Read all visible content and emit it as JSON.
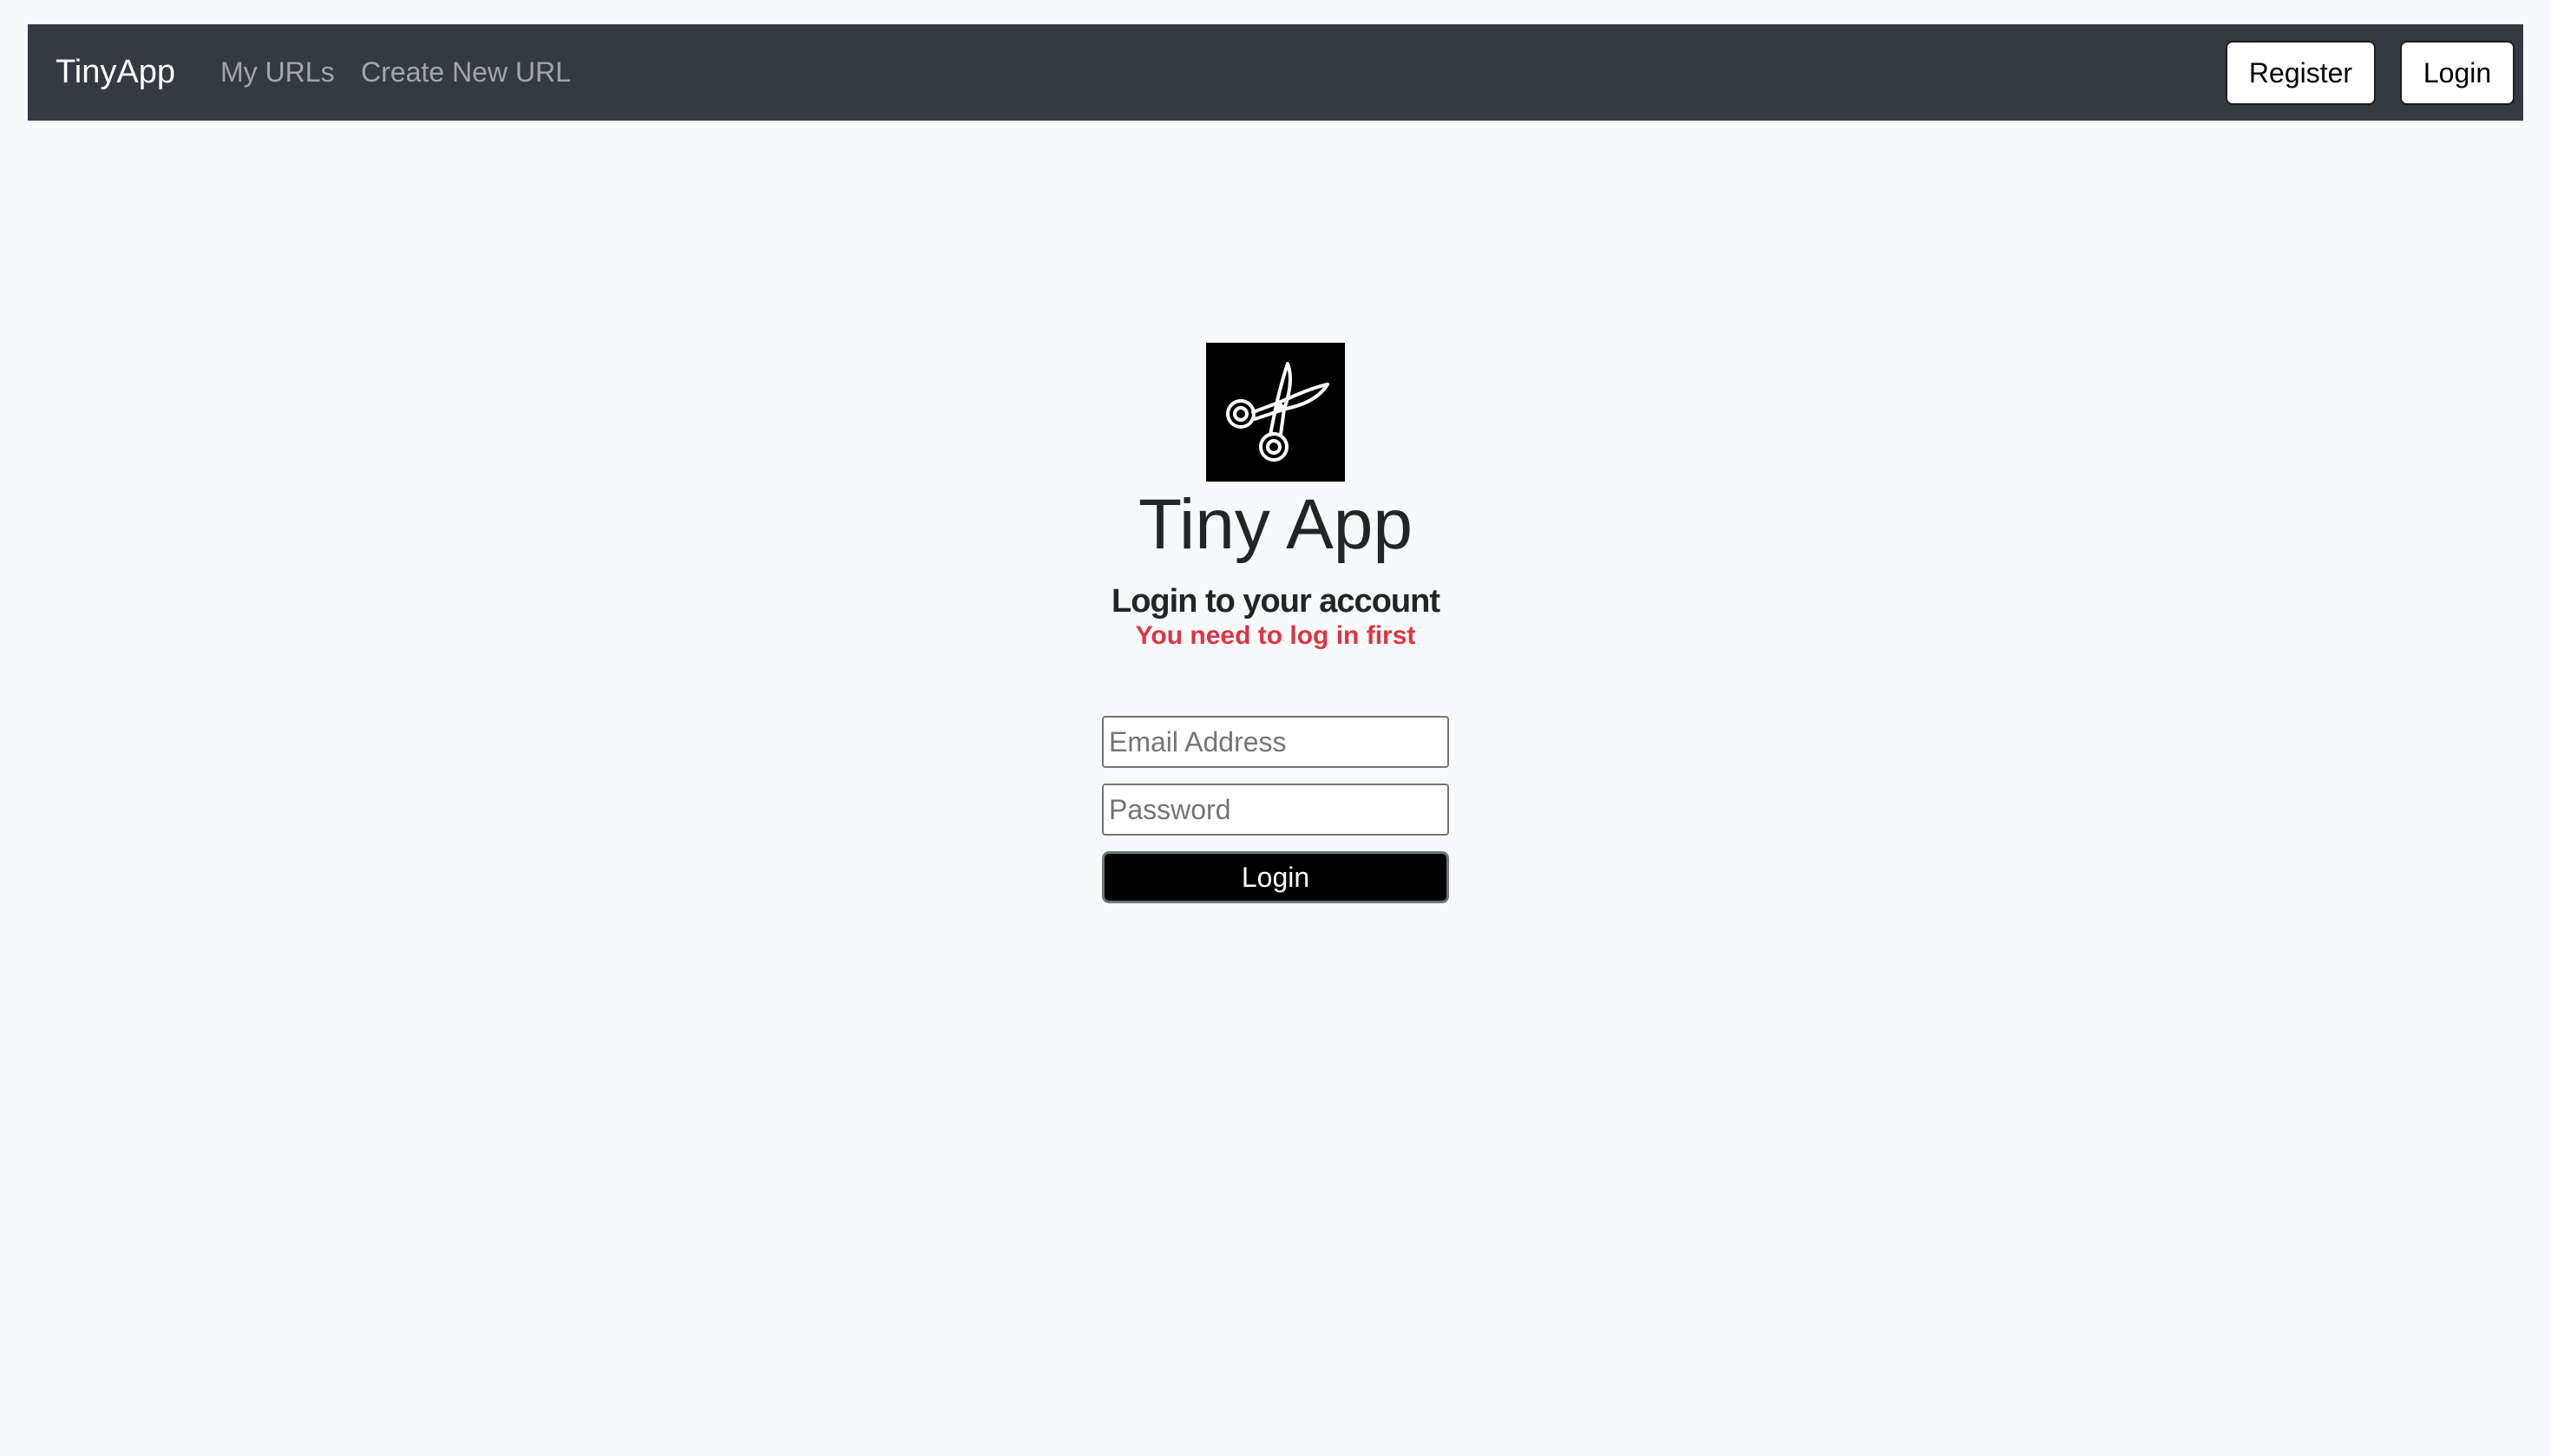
{
  "navbar": {
    "brand": "TinyApp",
    "links": [
      {
        "label": "My URLs"
      },
      {
        "label": "Create New URL"
      }
    ],
    "register_label": "Register",
    "login_label": "Login"
  },
  "hero": {
    "logo_icon": "scissors-icon",
    "title": "Tiny App",
    "subtitle": "Login to your account",
    "error": "You need to log in first"
  },
  "form": {
    "email_placeholder": "Email Address",
    "email_value": "",
    "password_placeholder": "Password",
    "password_value": "",
    "submit_label": "Login"
  },
  "colors": {
    "navbar_bg": "#343a40",
    "page_bg": "#f8f9fa",
    "error": "#dc3545",
    "primary_button": "#000000"
  }
}
